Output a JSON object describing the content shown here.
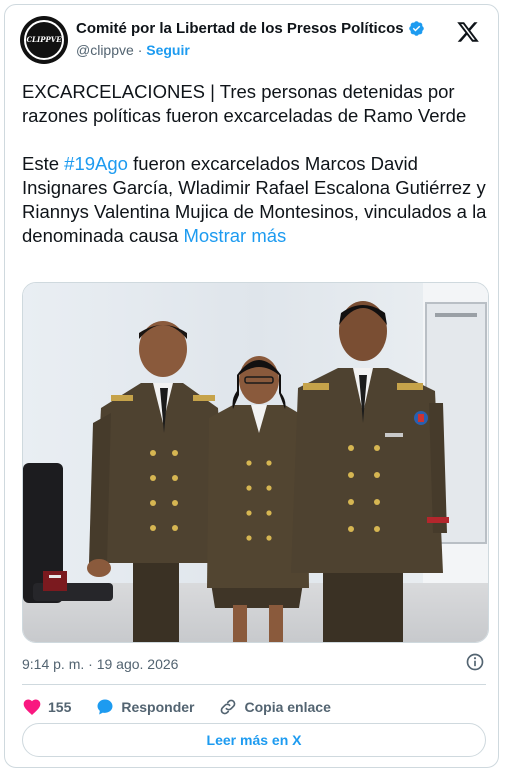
{
  "account": {
    "name": "Comité por la Libertad de los Presos Políticos",
    "handle": "@clippve",
    "separator": "·",
    "follow_label": "Seguir",
    "avatar_text": "CLIPPVE"
  },
  "tweet": {
    "headline": "EXCARCELACIONES | Tres personas detenidas por razones políticas fueron excarceladas de Ramo Verde",
    "body_prefix": "Este ",
    "hashtag": "#19Ago",
    "body_rest": " fueron excarcelados Marcos David Insignares García, Wladimir Rafael Escalona Gutiérrez y Riannys Valentina Mujica de Montesinos, vinculados a la denominada causa ",
    "show_more": "Mostrar más"
  },
  "meta": {
    "timestamp": "9:14 p. m. · 19 ago. 2026"
  },
  "actions": {
    "like_count": "155",
    "reply_label": "Responder",
    "copy_link_label": "Copia enlace"
  },
  "footer": {
    "read_more_label": "Leer más en X"
  },
  "colors": {
    "accent": "#1d9bf0",
    "like": "#f91880",
    "uniform": "#4a3d2a",
    "text_secondary": "#536471"
  },
  "icons": [
    "verified-badge-icon",
    "x-logo-icon",
    "info-icon",
    "heart-icon",
    "reply-icon",
    "link-icon"
  ]
}
